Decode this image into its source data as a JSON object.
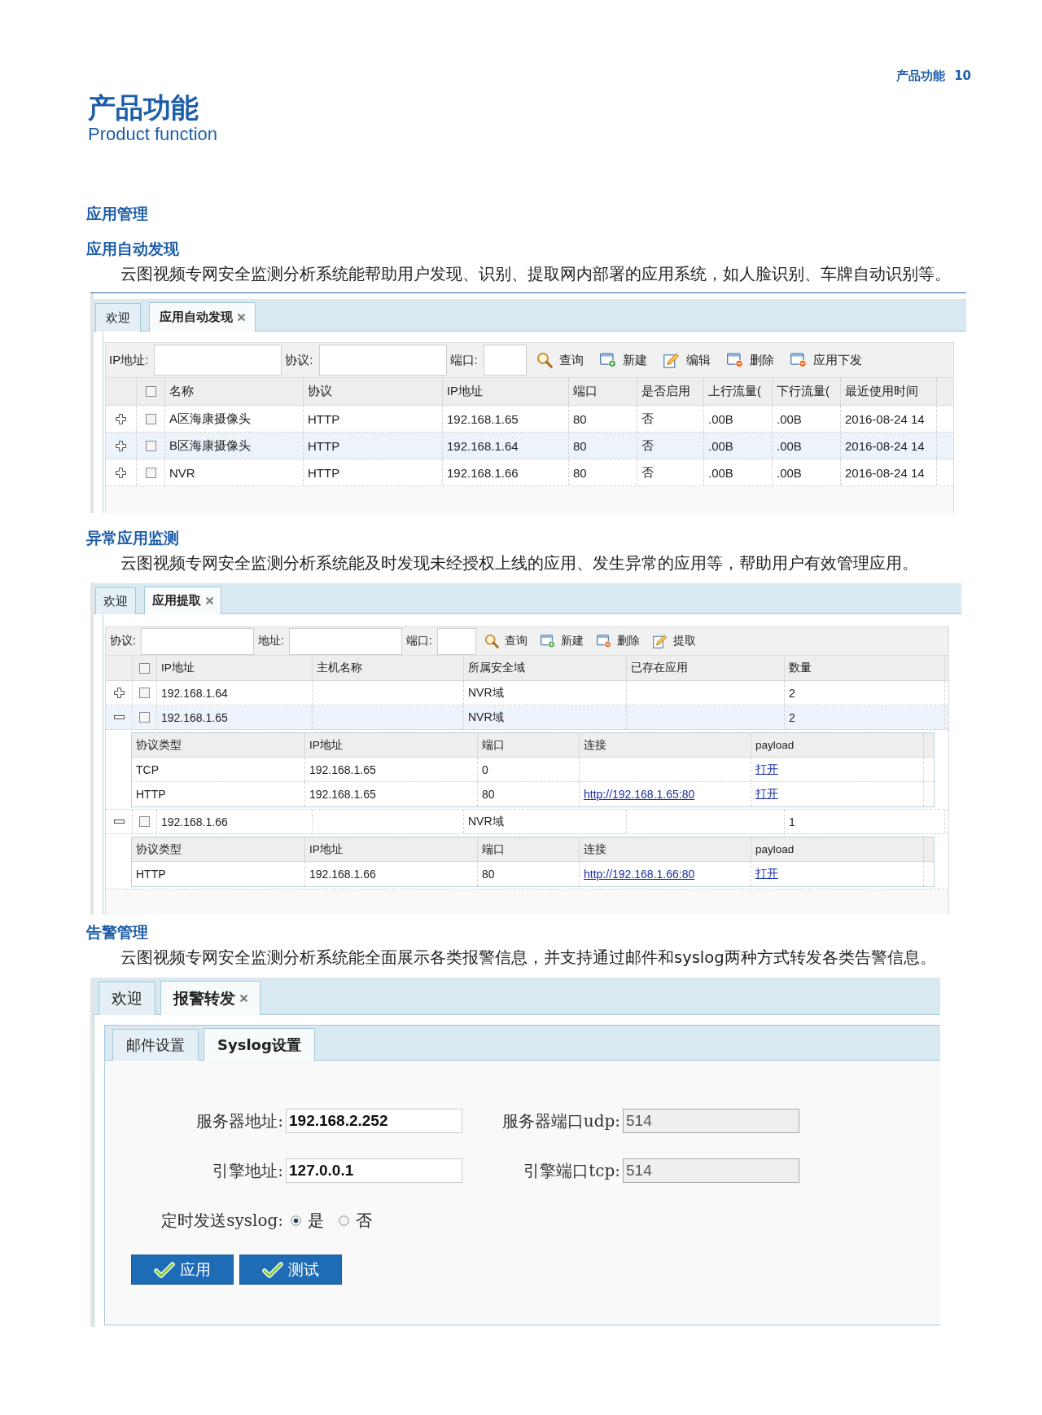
{
  "running_header": {
    "section": "产品功能",
    "page_number": "10"
  },
  "title": {
    "chinese": "产品功能",
    "english": "Product function"
  },
  "sections": [
    {
      "heading": "应用管理",
      "subsections": [
        {
          "heading": "应用自动发现",
          "paragraph": "云图视频专网安全监测分析系统能帮助用户发现、识别、提取网内部署的应用系统，如人脸识别、车牌自动识别等。",
          "screen": {
            "kind": "discovery",
            "tabs": [
              {
                "label": "欢迎",
                "selected": false,
                "closable": false
              },
              {
                "label": "应用自动发现",
                "selected": true,
                "closable": true
              }
            ],
            "filters": [
              {
                "label": "IP地址:"
              },
              {
                "label": "协议:"
              },
              {
                "label": "端口:"
              }
            ],
            "actions": [
              {
                "kind": "search",
                "label": "查询"
              },
              {
                "kind": "create",
                "label": "新建"
              },
              {
                "kind": "edit",
                "label": "编辑"
              },
              {
                "kind": "delete",
                "label": "删除"
              },
              {
                "kind": "deploy",
                "label": "应用下发"
              }
            ],
            "all_checked": false,
            "columns": [
              "名称",
              "协议",
              "IP地址",
              "端口",
              "是否启用",
              "上行流量(",
              "下行流量(",
              "最近使用时间"
            ],
            "rows": [
              {
                "expanded": false,
                "checked": false,
                "name": "A区海康摄像头",
                "protocol": "HTTP",
                "ip_address": "192.168.1.65",
                "port": "80",
                "enabled": "否",
                "upstream": ".00B",
                "downstream": ".00B",
                "last_used": "2016-08-24 14"
              },
              {
                "expanded": false,
                "checked": false,
                "name": "B区海康摄像头",
                "protocol": "HTTP",
                "ip_address": "192.168.1.64",
                "port": "80",
                "enabled": "否",
                "upstream": ".00B",
                "downstream": ".00B",
                "last_used": "2016-08-24 14"
              },
              {
                "expanded": false,
                "checked": false,
                "name": "NVR",
                "protocol": "HTTP",
                "ip_address": "192.168.1.66",
                "port": "80",
                "enabled": "否",
                "upstream": ".00B",
                "downstream": ".00B",
                "last_used": "2016-08-24 14"
              }
            ]
          }
        },
        {
          "heading": "异常应用监测",
          "paragraph": "云图视频专网安全监测分析系统能及时发现未经授权上线的应用、发生异常的应用等，帮助用户有效管理应用。",
          "screen": {
            "kind": "extraction",
            "tabs": [
              {
                "label": "欢迎",
                "selected": false,
                "closable": false
              },
              {
                "label": "应用提取",
                "selected": true,
                "closable": true
              }
            ],
            "filters": [
              {
                "label": "协议:"
              },
              {
                "label": "地址:"
              },
              {
                "label": "端口:"
              }
            ],
            "actions": [
              {
                "kind": "search",
                "label": "查询"
              },
              {
                "kind": "create",
                "label": "新建"
              },
              {
                "kind": "delete",
                "label": "删除"
              },
              {
                "kind": "extract",
                "label": "提取"
              }
            ],
            "all_checked": false,
            "columns": [
              "IP地址",
              "主机名称",
              "所属安全域",
              "已存在应用",
              "数量"
            ],
            "rows": [
              {
                "expanded": false,
                "checked": false,
                "ip_address": "192.168.1.64",
                "security_domain": "NVR域",
                "count": "2"
              },
              {
                "expanded": true,
                "checked": false,
                "ip_address": "192.168.1.65",
                "security_domain": "NVR域",
                "count": "2",
                "details": {
                  "columns": [
                    "协议类型",
                    "IP地址",
                    "端口",
                    "连接",
                    "payload"
                  ],
                  "rows": [
                    {
                      "protocol_type": "TCP",
                      "ip_address": "192.168.1.65",
                      "port": "0",
                      "payload": "打开"
                    },
                    {
                      "protocol_type": "HTTP",
                      "ip_address": "192.168.1.65",
                      "port": "80",
                      "link": "http://192.168.1.65:80",
                      "payload": "打开"
                    }
                  ]
                }
              },
              {
                "expanded": true,
                "checked": false,
                "ip_address": "192.168.1.66",
                "security_domain": "NVR域",
                "count": "1",
                "details": {
                  "columns": [
                    "协议类型",
                    "IP地址",
                    "端口",
                    "连接",
                    "payload"
                  ],
                  "rows": [
                    {
                      "protocol_type": "HTTP",
                      "ip_address": "192.168.1.66",
                      "port": "80",
                      "link": "http://192.168.1.66:80",
                      "payload": "打开"
                    }
                  ]
                }
              }
            ]
          }
        }
      ]
    },
    {
      "heading": "告警管理",
      "paragraph": "云图视频专网安全监测分析系统能全面展示各类报警信息，并支持通过邮件和syslog两种方式转发各类告警信息。",
      "screen": {
        "kind": "alarm_form",
        "tabs": [
          {
            "label": "欢迎",
            "selected": false,
            "closable": false
          },
          {
            "label": "报警转发",
            "selected": true,
            "closable": true
          }
        ],
        "sub_tabs": [
          {
            "label": "邮件设置",
            "selected": false
          },
          {
            "label": "Syslog设置",
            "selected": true
          }
        ],
        "fields": [
          {
            "label": "服务器地址:",
            "value": "192.168.2.252",
            "disabled": false
          },
          {
            "label": "服务器端口udp:",
            "value": "514",
            "disabled": true
          },
          {
            "label": "引擎地址:",
            "value": "127.0.0.1",
            "disabled": false
          },
          {
            "label": "引擎端口tcp:",
            "value": "514",
            "disabled": true
          }
        ],
        "schedule": {
          "label": "定时发送syslog:",
          "options": [
            {
              "label": "是",
              "selected": true
            },
            {
              "label": "否",
              "selected": false
            }
          ]
        },
        "buttons": [
          "应用",
          "测试"
        ]
      }
    }
  ]
}
